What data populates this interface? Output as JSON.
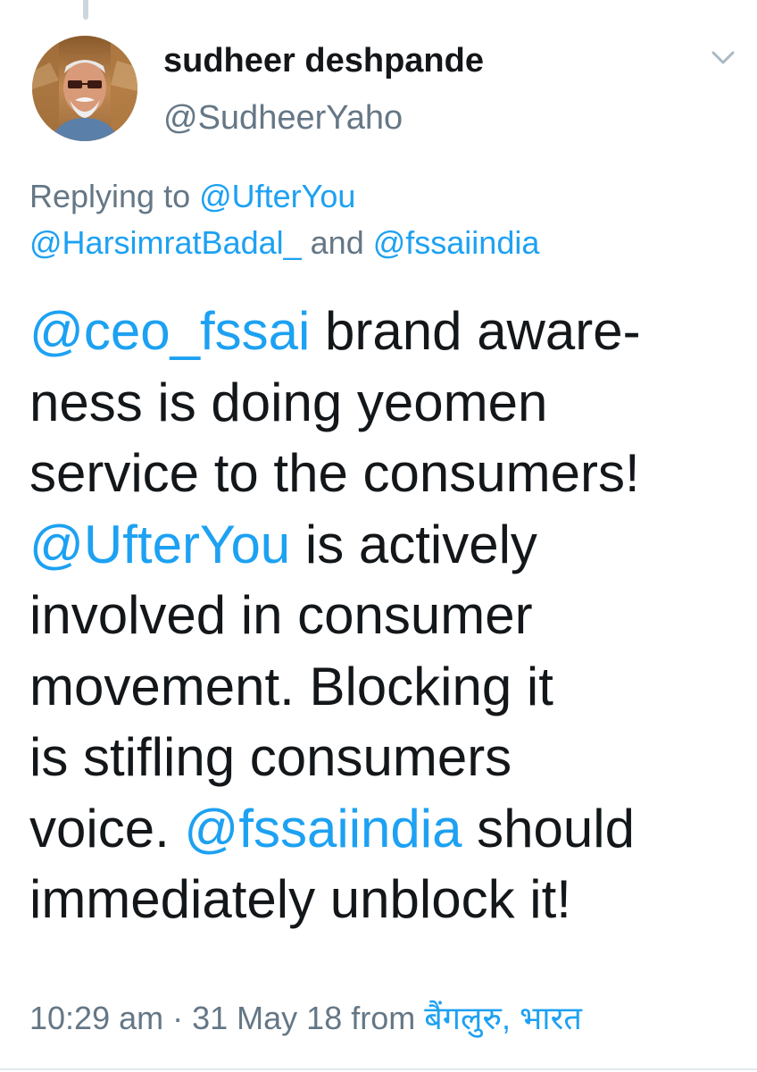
{
  "author": {
    "display_name": "sudheer deshpande",
    "handle": "@SudheerYaho",
    "avatar_icon": "user-avatar-photo"
  },
  "header": {
    "more_icon": "chevron-down-icon"
  },
  "replying": {
    "prefix": "Replying to ",
    "mention_1": "@UfterYou",
    "mention_2": "@HarsimratBadal_",
    "conjunction": " and ",
    "mention_3": "@fssaiindia"
  },
  "tweet": {
    "line1_mention": "@ceo_fssai",
    "line1_text": " brand aware-",
    "line2": "ness is doing yeomen",
    "line3": "service to the consumers!",
    "line4_mention": "@UfterYou",
    "line4_text": " is actively",
    "line5": "involved in consumer",
    "line6": "movement. Blocking it",
    "line7": "is stifling consumers",
    "line8_text": "voice. ",
    "line8_mention": "@fssaiindia",
    "line8_tail": " should",
    "line9": "immediately unblock it!"
  },
  "meta": {
    "time": "10:29 am",
    "separator": " · ",
    "date": "31 May 18",
    "from": " from ",
    "location": "बैंगलुरु, भारत"
  },
  "colors": {
    "link": "#1da1f2",
    "secondary": "#657786",
    "text": "#14171a"
  }
}
